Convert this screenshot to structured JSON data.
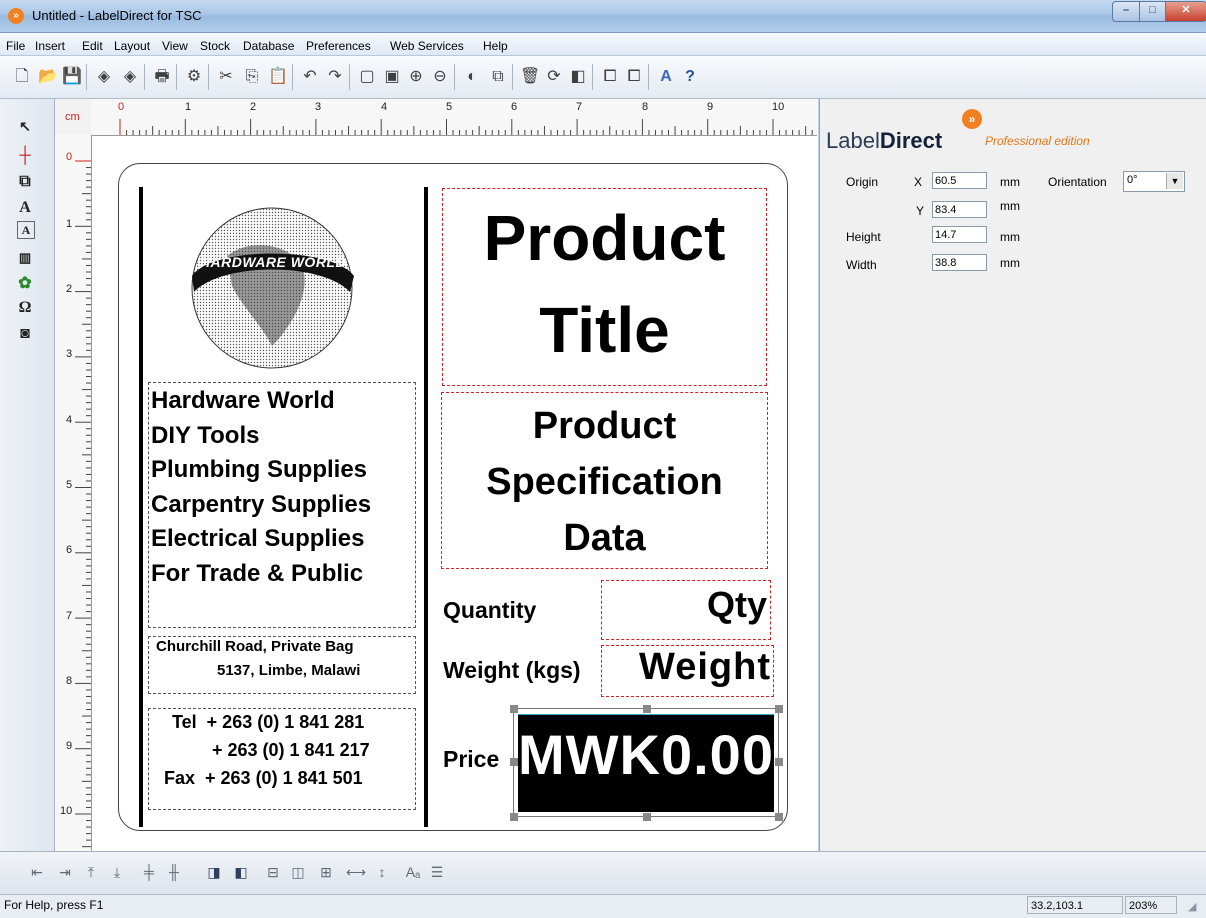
{
  "window": {
    "title": "Untitled - LabelDirect for TSC",
    "app_icon": "»",
    "min": "–",
    "max": "□",
    "close": "✕"
  },
  "menu": [
    "File",
    "Insert",
    "Edit",
    "Layout",
    "View",
    "Stock",
    "Database",
    "Preferences",
    "Web Services",
    "Help"
  ],
  "ruler": {
    "unit": "cm",
    "h_numbers": [
      "0",
      "1",
      "2",
      "3",
      "4",
      "5",
      "6",
      "7",
      "8",
      "9",
      "10"
    ],
    "v_numbers": [
      "0",
      "1",
      "2",
      "3",
      "4",
      "5",
      "6",
      "7",
      "8",
      "9",
      "10"
    ]
  },
  "label": {
    "logo_text": "HARDWARE WORLD",
    "company_lines": [
      "Hardware World",
      "DIY Tools",
      "Plumbing Supplies",
      "Carpentry Supplies",
      "Electrical Supplies",
      "For Trade & Public"
    ],
    "address_lines": [
      "Churchill Road, Private Bag",
      "5137, Limbe, Malawi"
    ],
    "phone_lines": [
      "Tel  + 263 (0) 1 841 281",
      "+ 263 (0) 1 841 217",
      "Fax  + 263 (0) 1 841 501"
    ],
    "product_title": [
      "Product",
      "Title"
    ],
    "product_spec": [
      "Product",
      "Specification",
      "Data"
    ],
    "quantity_label": "Quantity",
    "quantity_value": "Qty",
    "weight_label": "Weight (kgs)",
    "weight_value": "Weight",
    "price_label": "Price",
    "price_value": "MWK0.00"
  },
  "panel": {
    "brand_light": "Label",
    "brand_bold": "Direct",
    "brand_sub": "Professional edition",
    "brand_logo": "»",
    "origin_label": "Origin",
    "x_label": "X",
    "x_value": "60.5",
    "y_label": "Y",
    "y_value": "83.4",
    "height_label": "Height",
    "height_value": "14.7",
    "width_label": "Width",
    "width_value": "38.8",
    "unit": "mm",
    "orientation_label": "Orientation",
    "orientation_value": "0°"
  },
  "status": {
    "help": "For Help, press F1",
    "coords": "33.2,103.1",
    "zoom": "203%"
  }
}
